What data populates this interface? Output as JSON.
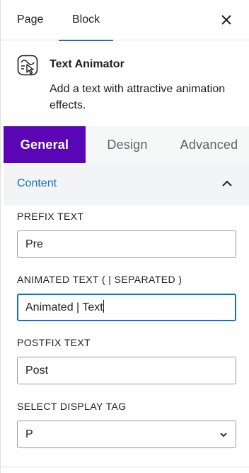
{
  "top_tabs": {
    "page_label": "Page",
    "block_label": "Block",
    "close_icon": "close-icon"
  },
  "block": {
    "icon": "text-animator-icon",
    "title": "Text Animator",
    "description": "Add a text with attractive animation effects."
  },
  "inspector_tabs": [
    {
      "label": "General",
      "active": true
    },
    {
      "label": "Design",
      "active": false
    },
    {
      "label": "Advanced",
      "active": false
    }
  ],
  "section": {
    "title": "Content",
    "expanded": true
  },
  "fields": {
    "prefix": {
      "label": "PREFIX TEXT",
      "value": "Pre"
    },
    "animated": {
      "label": "ANIMATED TEXT ( | SEPARATED )",
      "value": "Animated | Text"
    },
    "postfix": {
      "label": "POSTFIX TEXT",
      "value": "Post"
    },
    "tag": {
      "label": "SELECT DISPLAY TAG",
      "value": "P"
    }
  },
  "colors": {
    "active_tab_bg": "#5b06b6",
    "link_blue": "#1273c0",
    "focus_border": "#1273c0"
  }
}
